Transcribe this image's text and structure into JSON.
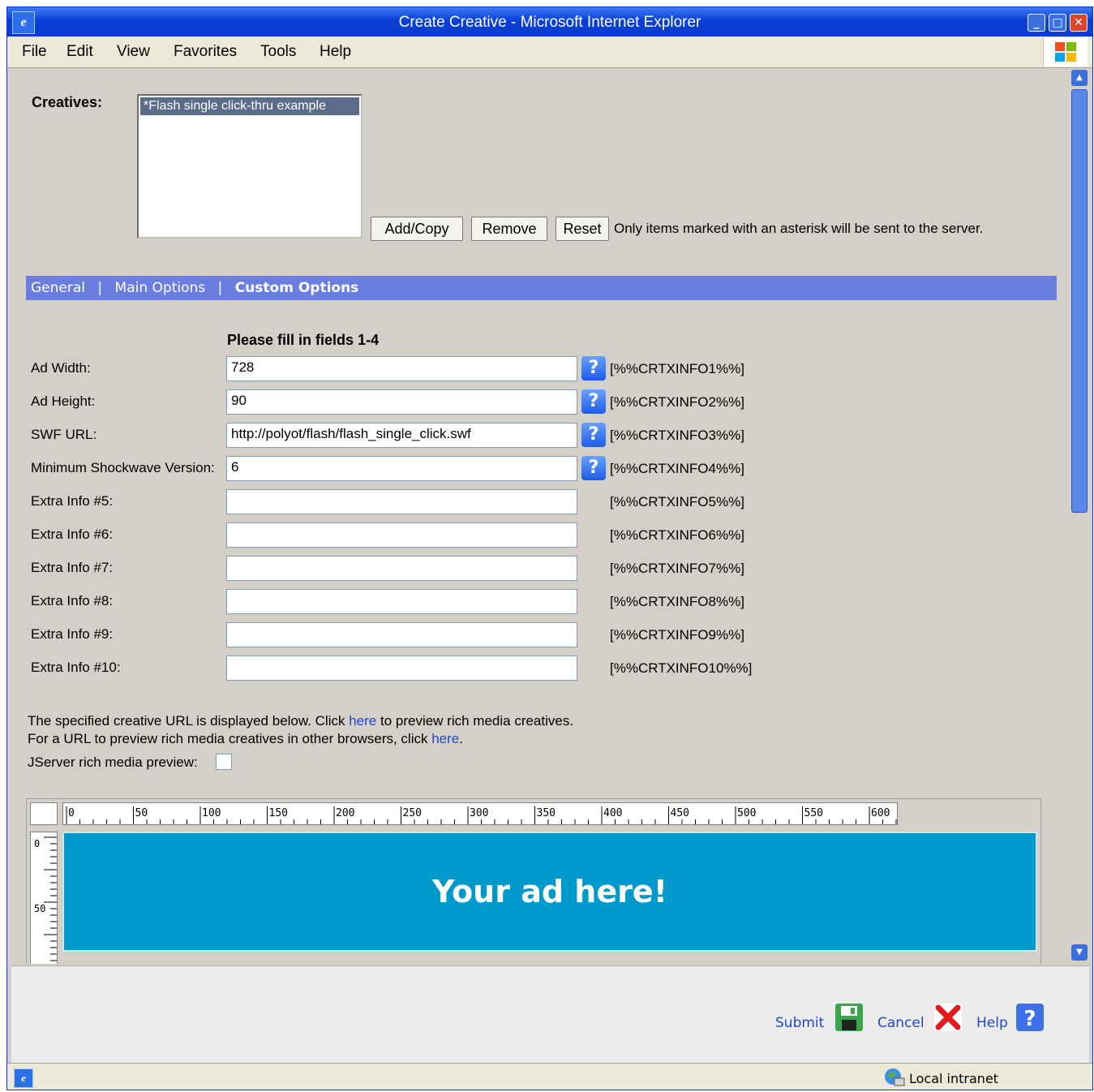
{
  "window": {
    "title": "Create Creative - Microsoft Internet Explorer"
  },
  "menu": [
    "File",
    "Edit",
    "View",
    "Favorites",
    "Tools",
    "Help"
  ],
  "creatives": {
    "label": "Creatives:",
    "items": [
      "*Flash single click-thru example"
    ],
    "buttons": {
      "add_copy": "Add/Copy",
      "remove": "Remove",
      "reset": "Reset"
    },
    "note": "Only items marked with an asterisk will be sent to the server."
  },
  "tabs": {
    "general": "General",
    "sep1": "|",
    "main_options": "Main Options",
    "sep2": "|",
    "custom_options": "Custom Options"
  },
  "form": {
    "heading": "Please fill in fields 1-4",
    "fields": [
      {
        "label": "Ad Width:",
        "value": "728",
        "token": "[%%CRTXINFO1%%]",
        "help": "?"
      },
      {
        "label": "Ad Height:",
        "value": "90",
        "token": "[%%CRTXINFO2%%]",
        "help": "?"
      },
      {
        "label": "SWF URL:",
        "value": "http://polyot/flash/flash_single_click.swf",
        "token": "[%%CRTXINFO3%%]",
        "help": "?"
      },
      {
        "label": "Minimum Shockwave Version:",
        "value": "6",
        "token": "[%%CRTXINFO4%%]",
        "help": "?"
      },
      {
        "label": "Extra Info #5:",
        "value": "",
        "token": "[%%CRTXINFO5%%]"
      },
      {
        "label": "Extra Info #6:",
        "value": "",
        "token": "[%%CRTXINFO6%%]"
      },
      {
        "label": "Extra Info #7:",
        "value": "",
        "token": "[%%CRTXINFO7%%]"
      },
      {
        "label": "Extra Info #8:",
        "value": "",
        "token": "[%%CRTXINFO8%%]"
      },
      {
        "label": "Extra Info #9:",
        "value": "",
        "token": "[%%CRTXINFO9%%]"
      },
      {
        "label": "Extra Info #10:",
        "value": "",
        "token": "[%%CRTXINFO10%%]"
      }
    ]
  },
  "preview": {
    "line1_pre": "The specified creative URL is displayed below. Click ",
    "line1_link": "here",
    "line1_post": " to preview rich media creatives.",
    "line2_pre": "For a URL to preview rich media creatives in other browsers, click ",
    "line2_link": "here",
    "line2_post": ".",
    "jserver_label": "JServer rich media preview:",
    "jserver_checked": false,
    "ruler_h_labels": [
      "0",
      "50",
      "100",
      "150",
      "200",
      "250",
      "300",
      "350",
      "400",
      "450",
      "500",
      "550",
      "600"
    ],
    "ruler_v_labels": [
      "0",
      "50"
    ],
    "ad_text": "Your ad here!"
  },
  "footer": {
    "submit": "Submit",
    "cancel": "Cancel",
    "help": "Help"
  },
  "status": {
    "zone": "Local intranet"
  },
  "colors": {
    "tabbar": "#6b7ee0",
    "link": "#2248c8",
    "ad_bg": "#0099cc",
    "titlebar": "#0a3fd8"
  }
}
